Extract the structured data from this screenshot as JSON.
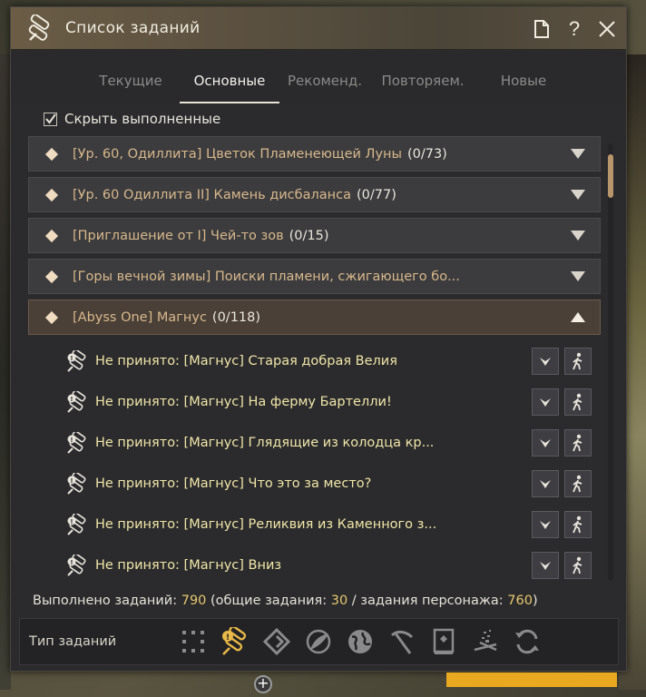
{
  "window": {
    "title": "Список заданий"
  },
  "tabs": [
    {
      "label": "Текущие",
      "active": false
    },
    {
      "label": "Основные",
      "active": true
    },
    {
      "label": "Рекоменд.",
      "active": false
    },
    {
      "label": "Повторяем.",
      "active": false
    },
    {
      "label": "Новые",
      "active": false
    }
  ],
  "filter": {
    "hide_completed_label": "Скрыть выполненные",
    "hide_completed_checked": true
  },
  "quests": [
    {
      "title": "[Ур. 60, Одиллита] Цветок Пламенеющей Луны",
      "count": "(0/73)",
      "expanded": false
    },
    {
      "title": "[Ур. 60 Одиллита II] Камень дисбаланса",
      "count": "(0/77)",
      "expanded": false
    },
    {
      "title": "[Приглашение от I] Чей-то зов",
      "count": "(0/15)",
      "expanded": false
    },
    {
      "title": "[Горы вечной зимы] Поиски пламени, сжигающего бо...",
      "count": "",
      "expanded": false
    },
    {
      "title": "[Abyss One] Магнус",
      "count": "(0/118)",
      "expanded": true
    }
  ],
  "subquests": [
    {
      "title": "Не принято: [Магнус] Старая добрая Велия"
    },
    {
      "title": "Не принято: [Магнус] На ферму Бартелли!"
    },
    {
      "title": "Не принято: [Магнус] Глядящие из колодца кр..."
    },
    {
      "title": "Не принято: [Магнус] Что это за место?"
    },
    {
      "title": "Не принято: [Магнус] Реликвия из Каменного з..."
    },
    {
      "title": "Не принято: [Магнус] Вниз"
    }
  ],
  "summary": {
    "completed_label": "Выполнено заданий:",
    "completed_total": "790",
    "general_label": "(общие задания:",
    "general_count": "30",
    "separator": "/",
    "character_label": "задания персонажа:",
    "character_count": "760",
    "close_paren": ")"
  },
  "type_bar": {
    "label": "Тип заданий",
    "icons": [
      "grid-select-icon",
      "scroll-quest-icon",
      "diamond-road-icon",
      "leaf-circle-icon",
      "globe-icon",
      "scythe-icon",
      "book-icon",
      "campfire-icon",
      "refresh-icon"
    ]
  },
  "colors": {
    "accent": "#b8956a",
    "quest_title": "#d8b88c",
    "subquest_title": "#f0e6a8",
    "number_highlight": "#e6c870"
  }
}
